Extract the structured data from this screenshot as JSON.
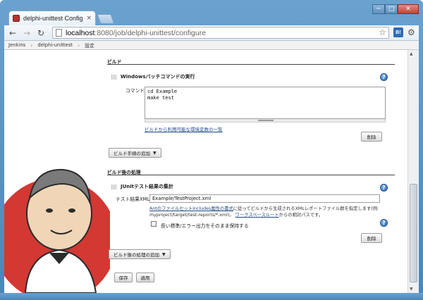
{
  "browser": {
    "tab_title": "delphi-unittest Config [",
    "tab_close": "×",
    "window_buttons": {
      "minimize": "─",
      "maximize": "□",
      "close": "✕"
    },
    "url_host": "localhost",
    "url_path": ":8080/job/delphi-unittest/configure",
    "extension_label": "B!",
    "icons": [
      "back-icon",
      "forward-icon",
      "reload-icon",
      "star-icon",
      "wrench-icon"
    ]
  },
  "breadcrumb": [
    "Jenkins",
    "delphi-unittest",
    "設定"
  ],
  "build": {
    "section_title": "ビルド",
    "step_title": "Windowsバッチコマンドの実行",
    "command_label": "コマンド",
    "command_value": "cd Example\nmake test",
    "env_link": "ビルドから利用可能な環境変数の一覧",
    "delete_label": "削除",
    "add_step_label": "ビルド手順の追加"
  },
  "post_build": {
    "section_title": "ビルド後の処理",
    "step_title": "JUnitテスト結果の集計",
    "xml_label": "テスト結果XML",
    "xml_value": "Example/TestProject.xml",
    "desc_link1": "Antのファイルセットincludes属性の書式",
    "desc_text1": "に従ってビルドから生成されるXMLレポートファイル群を指定します(例:",
    "desc_text2": "myproject/target/test-reports/*.xml)。",
    "desc_link2": "ワークスペースルート",
    "desc_text3": "からの相対パスです。",
    "keep_output_label": "長い標準/エラー出力をそのまま保持する",
    "delete_label": "削除",
    "add_action_label": "ビルド後の処理の追加"
  },
  "footer": {
    "save_label": "保存",
    "apply_label": "適用"
  },
  "colors": {
    "frame": "#5b93c4",
    "link": "#204a87",
    "help_icon": "#2a66b8"
  }
}
